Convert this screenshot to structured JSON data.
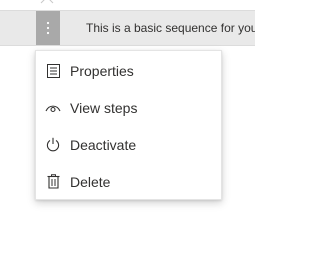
{
  "row": {
    "description": "This is a basic sequence for you",
    "colors": {
      "row_background": "#e9e9e9",
      "button_background": "#a9a9a9",
      "text": "#323130"
    }
  },
  "menu": {
    "items": [
      {
        "label": "Properties",
        "icon": "properties-icon"
      },
      {
        "label": "View steps",
        "icon": "view-icon"
      },
      {
        "label": "Deactivate",
        "icon": "power-icon"
      },
      {
        "label": "Delete",
        "icon": "trash-icon"
      }
    ]
  }
}
